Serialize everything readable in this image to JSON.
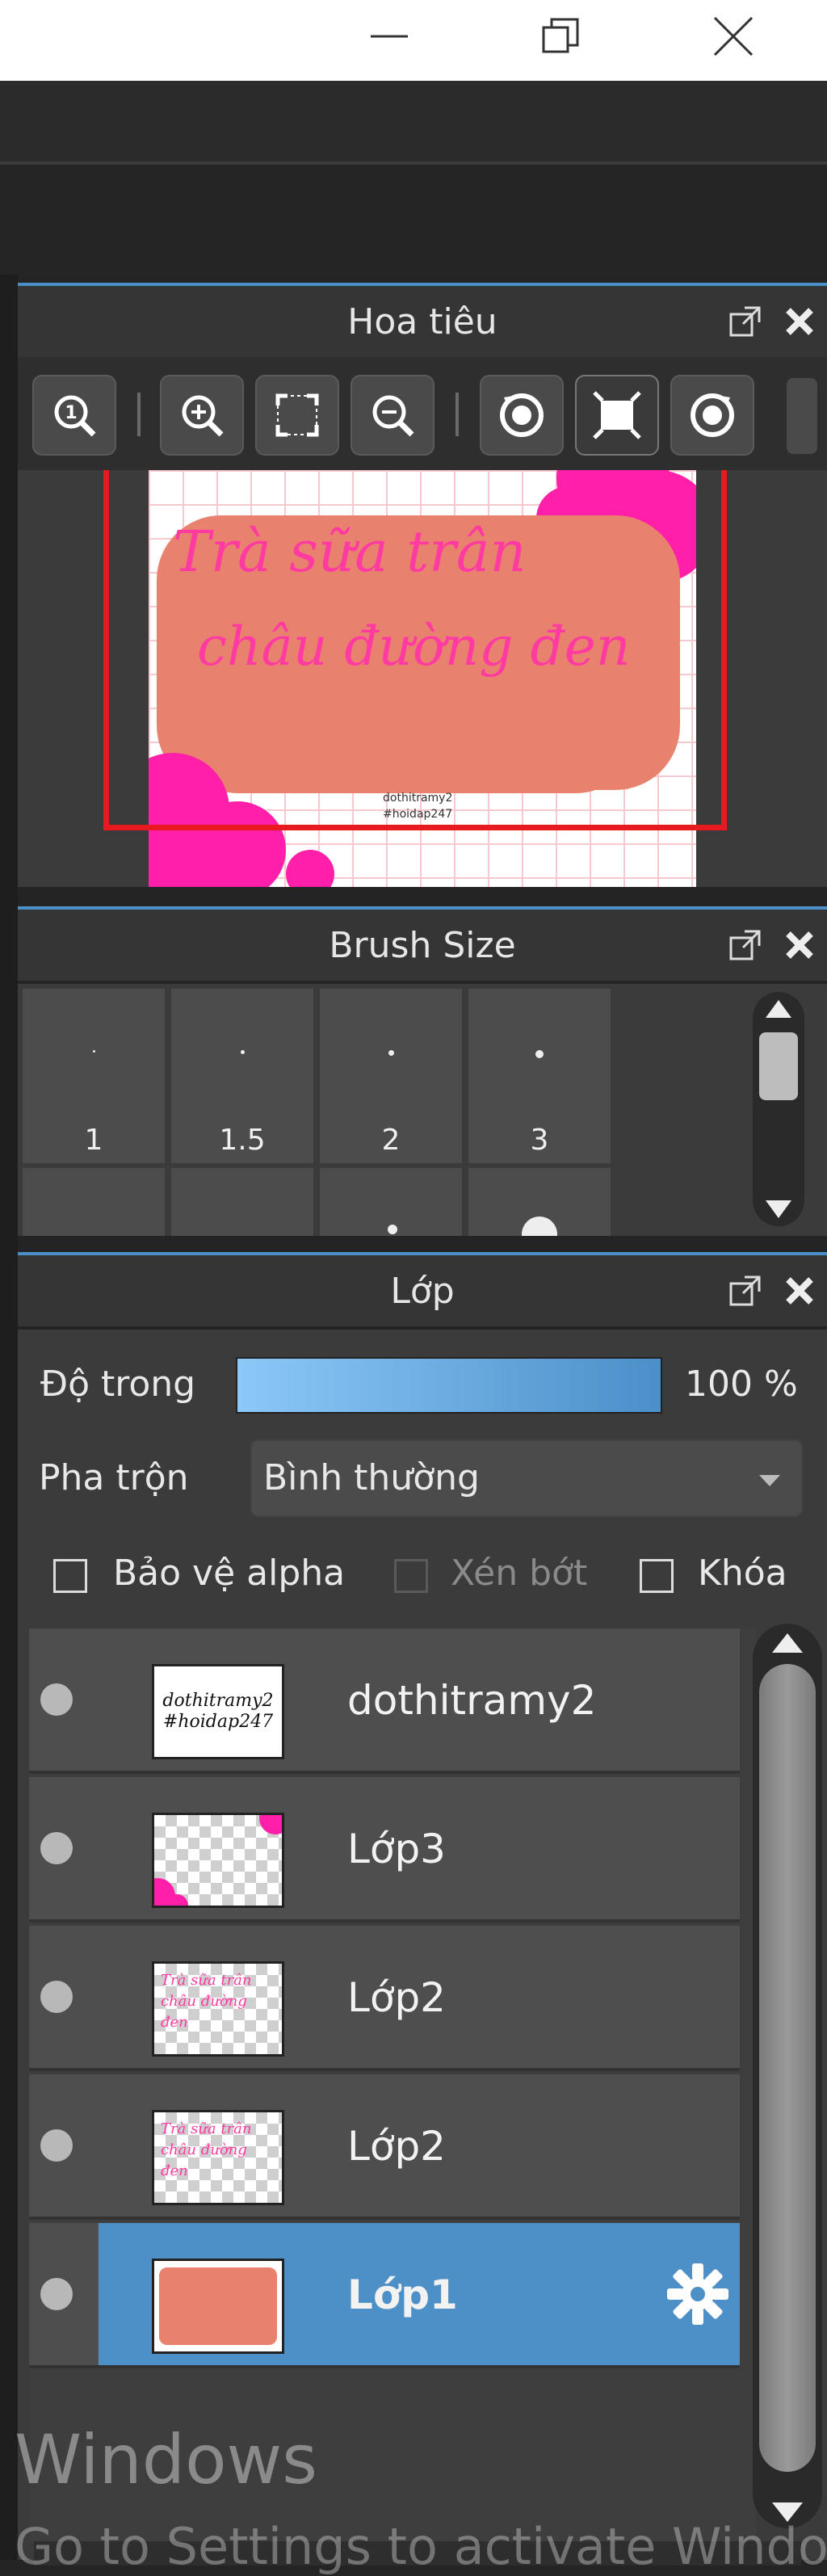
{
  "navigator": {
    "title": "Hoa tiêu",
    "artwork": {
      "line1": "Trà sữa trân",
      "line2": "châu đường đen",
      "credit1": "dothitramy2",
      "credit2": "#hoidap247"
    }
  },
  "brush_size": {
    "title": "Brush Size",
    "sizes": [
      "1",
      "1.5",
      "2",
      "3"
    ]
  },
  "layers": {
    "title": "Lớp",
    "opacity_label": "Độ trong",
    "opacity_value": "100 %",
    "opacity": 1.0,
    "blend_label": "Pha trộn",
    "blend_value": "Bình thường",
    "checkboxes": {
      "protect_alpha": "Bảo vệ alpha",
      "clipping": "Xén bớt",
      "lock": "Khóa"
    },
    "items": [
      {
        "name": "dothitramy2",
        "selected": false
      },
      {
        "name": "Lớp3",
        "selected": false
      },
      {
        "name": "Lớp2",
        "selected": false
      },
      {
        "name": "Lớp2",
        "selected": false
      },
      {
        "name": "Lớp1",
        "selected": true
      }
    ]
  },
  "watermark": {
    "line1": "Windows",
    "line2": "Go to Settings to activate Windows"
  },
  "colors": {
    "accent": "#4a8fc8",
    "selected_row": "#4d8fc7",
    "art_pink": "#ff1fa8",
    "art_salmon": "#e8826f",
    "art_text": "#ff3aa0"
  }
}
